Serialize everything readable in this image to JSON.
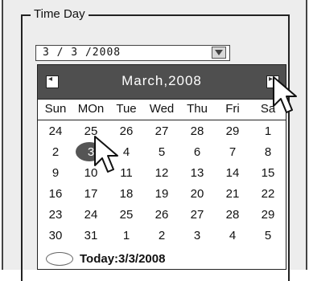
{
  "group": {
    "title": "Time Day"
  },
  "date_field": {
    "value": "3 /  3 /2008",
    "dropdown_icon": "triangle-down-icon"
  },
  "calendar": {
    "month_title": "March,2008",
    "prev_icon": "chevron-left-icon",
    "next_icon": "chevron-right-icon",
    "weekdays": [
      "Sun",
      "MOn",
      "Tue",
      "Wed",
      "Thu",
      "Fri",
      "Sa"
    ],
    "weeks": [
      [
        "24",
        "25",
        "26",
        "27",
        "28",
        "29",
        "1"
      ],
      [
        "2",
        "3",
        "4",
        "5",
        "6",
        "7",
        "8"
      ],
      [
        "9",
        "10",
        "11",
        "12",
        "13",
        "14",
        "15"
      ],
      [
        "16",
        "17",
        "18",
        "19",
        "20",
        "21",
        "22"
      ],
      [
        "23",
        "24",
        "25",
        "26",
        "27",
        "28",
        "29"
      ],
      [
        "30",
        "31",
        "1",
        "2",
        "3",
        "4",
        "5"
      ]
    ],
    "selected_day": "3",
    "today_label": "Today:3/3/2008"
  },
  "colors": {
    "header_bg": "#4f4f4f",
    "selection": "#555555"
  }
}
